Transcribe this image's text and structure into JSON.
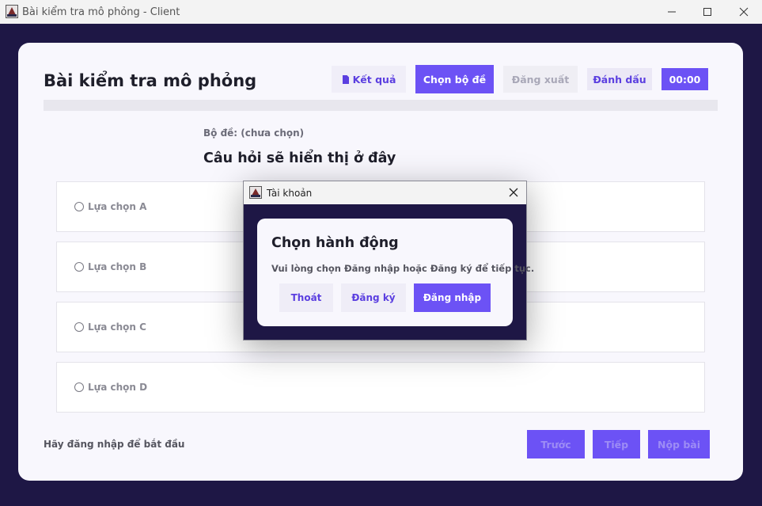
{
  "window": {
    "title": "Bài kiểm tra mô phỏng - Client"
  },
  "header": {
    "title": "Bài kiểm tra mô phỏng",
    "result_label": "Kết quả",
    "choose_set_label": "Chọn bộ đề",
    "logout_label": "Đăng xuất",
    "mark_label": "Đánh dấu",
    "timer": "00:00"
  },
  "progress": {
    "value": 0
  },
  "quiz": {
    "set_label": "Bộ đề: (chưa chọn)",
    "question": "Câu hỏi sẽ hiển thị ở đây",
    "options": [
      {
        "label": "Lựa chọn A"
      },
      {
        "label": "Lựa chọn B"
      },
      {
        "label": "Lựa chọn C"
      },
      {
        "label": "Lựa chọn D"
      }
    ]
  },
  "footer": {
    "status": "Hãy đăng nhập để bắt đầu",
    "prev_label": "Trước",
    "next_label": "Tiếp",
    "submit_label": "Nộp bài"
  },
  "dialog": {
    "title": "Tài khoản",
    "heading": "Chọn hành động",
    "message": "Vui lòng chọn Đăng nhập hoặc Đăng ký để tiếp tục.",
    "exit_label": "Thoát",
    "register_label": "Đăng ký",
    "login_label": "Đăng nhập"
  },
  "colors": {
    "accent": "#6c52f5",
    "background": "#1e1745",
    "card": "#f8f7fd"
  },
  "icons": {
    "app": "app-icon",
    "result": "document-icon",
    "minimize": "minimize-icon",
    "maximize": "maximize-icon",
    "close": "close-icon"
  }
}
